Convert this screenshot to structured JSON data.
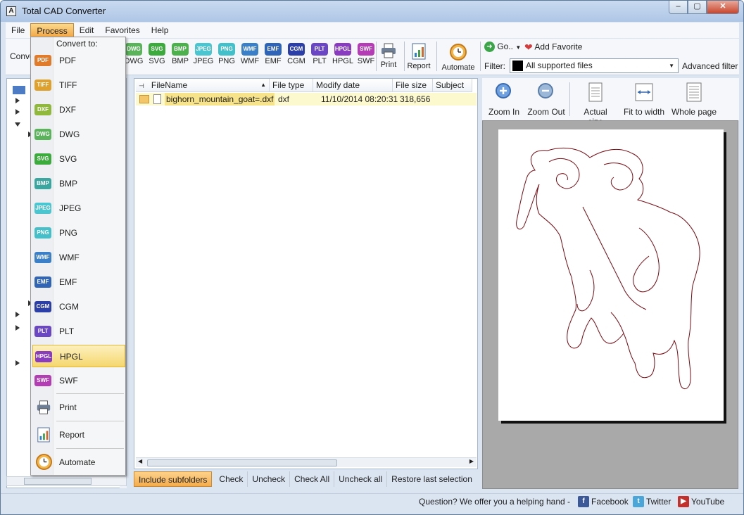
{
  "window": {
    "title": "Total CAD Converter"
  },
  "menu": [
    "File",
    "Process",
    "Edit",
    "Favorites",
    "Help"
  ],
  "toolbar": {
    "convert_label": "Conve",
    "formats": [
      {
        "label": "DWG",
        "badge": "DWG",
        "color": "#5bb45b"
      },
      {
        "label": "SVG",
        "badge": "SVG",
        "color": "#3caa3c"
      },
      {
        "label": "BMP",
        "badge": "BMP",
        "color": "#4cb04c"
      },
      {
        "label": "JPEG",
        "badge": "JPEG",
        "color": "#4bc5d0"
      },
      {
        "label": "PNG",
        "badge": "PNG",
        "color": "#43c0c9"
      },
      {
        "label": "WMF",
        "badge": "WMF",
        "color": "#3b7fc8"
      },
      {
        "label": "EMF",
        "badge": "EMF",
        "color": "#2f64b7"
      },
      {
        "label": "CGM",
        "badge": "CGM",
        "color": "#2c3ea8"
      },
      {
        "label": "PLT",
        "badge": "PLT",
        "color": "#6b46c4"
      },
      {
        "label": "HPGL",
        "badge": "HPGL",
        "color": "#8a3cc0"
      },
      {
        "label": "SWF",
        "badge": "SWF",
        "color": "#b43cb4"
      }
    ],
    "print": "Print",
    "report": "Report",
    "automate": "Automate",
    "goto": "Go..",
    "add_favorite": "Add Favorite",
    "filter_label": "Filter:",
    "filter_value": "All supported files",
    "advanced_filter": "Advanced filter"
  },
  "file_list": {
    "columns": [
      "FileName",
      "File type",
      "Modify date",
      "File size",
      "Subject"
    ],
    "rows": [
      {
        "name": "bighorn_mountain_goat=.dxf",
        "type": "dxf",
        "date": "11/10/2014 08:20:31",
        "size": "318,656"
      }
    ]
  },
  "preview": {
    "zoom_in": "Zoom In",
    "zoom_out": "Zoom Out",
    "actual_size": "Actual size",
    "fit_to_width": "Fit to width",
    "whole_page": "Whole page"
  },
  "bottom_buttons": {
    "include_subfolders": "Include subfolders",
    "check": "Check",
    "uncheck": "Uncheck",
    "check_all": "Check All",
    "uncheck_all": "Uncheck all",
    "restore": "Restore last selection"
  },
  "status": {
    "question": "Question? We offer you a helping hand -",
    "facebook": "Facebook",
    "twitter": "Twitter",
    "youtube": "YouTube"
  },
  "dropdown": {
    "header": "Convert to:",
    "items": [
      {
        "label": "PDF",
        "badge": "PDF",
        "color": "#e07b2c"
      },
      {
        "label": "TIFF",
        "badge": "TIFF",
        "color": "#e0a02c"
      },
      {
        "label": "DXF",
        "badge": "DXF",
        "color": "#8fb83c"
      },
      {
        "label": "DWG",
        "badge": "DWG",
        "color": "#5bb45b"
      },
      {
        "label": "SVG",
        "badge": "SVG",
        "color": "#3caa3c"
      },
      {
        "label": "BMP",
        "badge": "BMP",
        "color": "#3aa6a0"
      },
      {
        "label": "JPEG",
        "badge": "JPEG",
        "color": "#4bc5d0"
      },
      {
        "label": "PNG",
        "badge": "PNG",
        "color": "#43c0c9"
      },
      {
        "label": "WMF",
        "badge": "WMF",
        "color": "#3b7fc8"
      },
      {
        "label": "EMF",
        "badge": "EMF",
        "color": "#2f64b7"
      },
      {
        "label": "CGM",
        "badge": "CGM",
        "color": "#2c3ea8"
      },
      {
        "label": "PLT",
        "badge": "PLT",
        "color": "#6b46c4"
      },
      {
        "label": "HPGL",
        "badge": "HPGL",
        "color": "#8a3cc0"
      },
      {
        "label": "SWF",
        "badge": "SWF",
        "color": "#b43cb4"
      }
    ],
    "actions": [
      "Print",
      "Report",
      "Automate"
    ],
    "highlighted": "HPGL"
  }
}
